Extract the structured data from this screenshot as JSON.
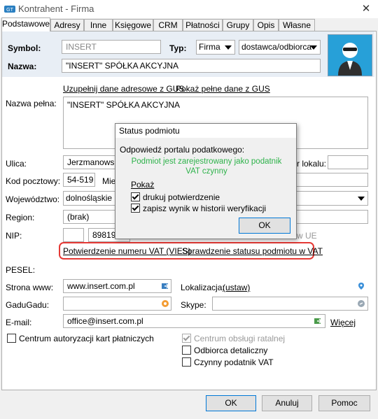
{
  "window": {
    "title": "Kontrahent - Firma",
    "close_glyph": "✕"
  },
  "tabs": [
    "Podstawowe",
    "Adresy",
    "Inne",
    "Księgowe",
    "CRM",
    "Płatności",
    "Grupy",
    "Opis",
    "Własne"
  ],
  "header": {
    "symbol_label": "Symbol:",
    "symbol_value": "INSERT",
    "typ_label": "Typ:",
    "typ_value": "Firma",
    "typ2_value": "dostawca/odbiorca",
    "nazwa_label": "Nazwa:",
    "nazwa_value": "\"INSERT\" SPÓŁKA AKCYJNA"
  },
  "links_top": {
    "gus_fill": "Uzupełnij dane adresowe z GUS",
    "gus_show": "Pokaż pełne dane z GUS"
  },
  "form": {
    "nazwa_pelna_label": "Nazwa pełna:",
    "nazwa_pelna_value": "\"INSERT\" SPÓŁKA AKCYJNA",
    "ulica_label": "Ulica:",
    "ulica_value": "Jerzmanowska",
    "lokal_label": "r lokalu:",
    "kod_label": "Kod pocztowy:",
    "kod_value": "54-519",
    "miejsc_label": "Miej",
    "woj_label": "Województwo:",
    "woj_value": "dolnośląskie",
    "region_label": "Region:",
    "region_value": "(brak)",
    "nip_label": "NIP:",
    "nip_value": "898194",
    "ue_label": "w UE",
    "pesel_label": "PESEL:",
    "www_label": "Strona www:",
    "www_value": "www.insert.com.pl",
    "lokalizacja_label": "Lokalizacja:",
    "ustaw_label": "(ustaw)",
    "gg_label": "GaduGadu:",
    "skype_label": "Skype:",
    "email_label": "E-mail:",
    "email_value": "office@insert.com.pl",
    "wiecej_label": "Więcej"
  },
  "vat_links": {
    "vies": "Potwierdzenie numeru VAT (VIES)",
    "status": "Sprawdzenie statusu podmiotu w VAT"
  },
  "checkboxes": {
    "centrum_karty": "Centrum autoryzacji kart płatniczych",
    "centrum_ratalne": "Centrum obsługi ratalnej",
    "odbiorca": "Odbiorca detaliczny",
    "czynny": "Czynny podatnik VAT"
  },
  "dialog": {
    "title": "Status podmiotu",
    "response_label": "Odpowiedź portalu podatkowego:",
    "response_text": "Podmiot jest zarejestrowany jako podatnik VAT czynny",
    "pokaz_label": "Pokaż",
    "print_label": "drukuj potwierdzenie",
    "save_label": "zapisz wynik w historii weryfikacji",
    "ok_label": "OK"
  },
  "footer": {
    "ok": "OK",
    "cancel": "Anuluj",
    "help": "Pomoc"
  },
  "colors": {
    "success_text": "#2db24a",
    "highlight": "#e53935",
    "avatar_bg": "#27a0d8"
  }
}
